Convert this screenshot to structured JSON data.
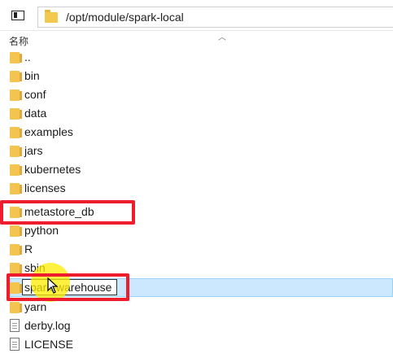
{
  "path_bar": {
    "path": "/opt/module/spark-local"
  },
  "header": {
    "name_col": "名称",
    "sort_icon": "chevron-up-icon"
  },
  "items": [
    {
      "name": "..",
      "type": "folder"
    },
    {
      "name": "bin",
      "type": "folder"
    },
    {
      "name": "conf",
      "type": "folder"
    },
    {
      "name": "data",
      "type": "folder"
    },
    {
      "name": "examples",
      "type": "folder"
    },
    {
      "name": "jars",
      "type": "folder"
    },
    {
      "name": "kubernetes",
      "type": "folder"
    },
    {
      "name": "licenses",
      "type": "folder"
    },
    {
      "name": "metastore_db",
      "type": "folder"
    },
    {
      "name": "python",
      "type": "folder"
    },
    {
      "name": "R",
      "type": "folder"
    },
    {
      "name": "sbin",
      "type": "folder"
    },
    {
      "name": "spark-warehouse",
      "type": "folder",
      "selected": true,
      "renaming": true
    },
    {
      "name": "yarn",
      "type": "folder"
    },
    {
      "name": "derby.log",
      "type": "file"
    },
    {
      "name": "LICENSE",
      "type": "file"
    }
  ],
  "annotations": {
    "highlight_color": "#ee1c2c",
    "cursor_glow": "#ffec00"
  }
}
